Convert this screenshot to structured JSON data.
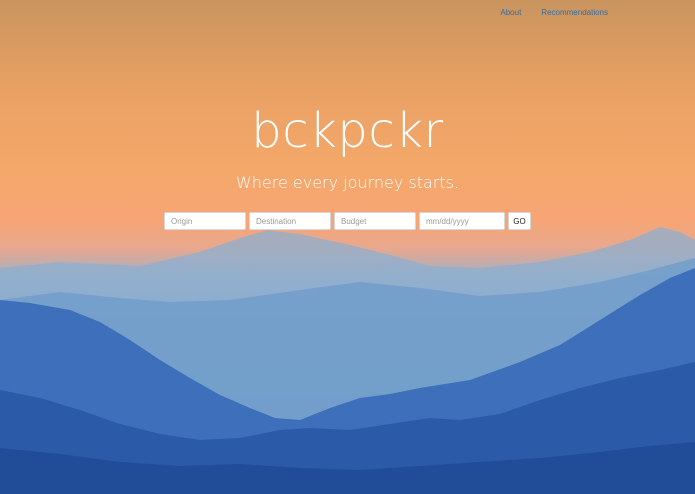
{
  "nav": {
    "about": "About",
    "recommendations": "Recommendations"
  },
  "hero": {
    "title": "bckpckr",
    "tagline": "Where every journey starts."
  },
  "search": {
    "origin_placeholder": "Origin",
    "destination_placeholder": "Destination",
    "budget_placeholder": "Budget",
    "date_placeholder": "mm/dd/yyyy",
    "go_label": "GO"
  },
  "colors": {
    "sky_top": "#c9945f",
    "sky_mid": "#f4a86a",
    "mountain_far": "#8fb3d4",
    "mountain_near": "#2c5db0",
    "link": "#2f6fa7"
  }
}
